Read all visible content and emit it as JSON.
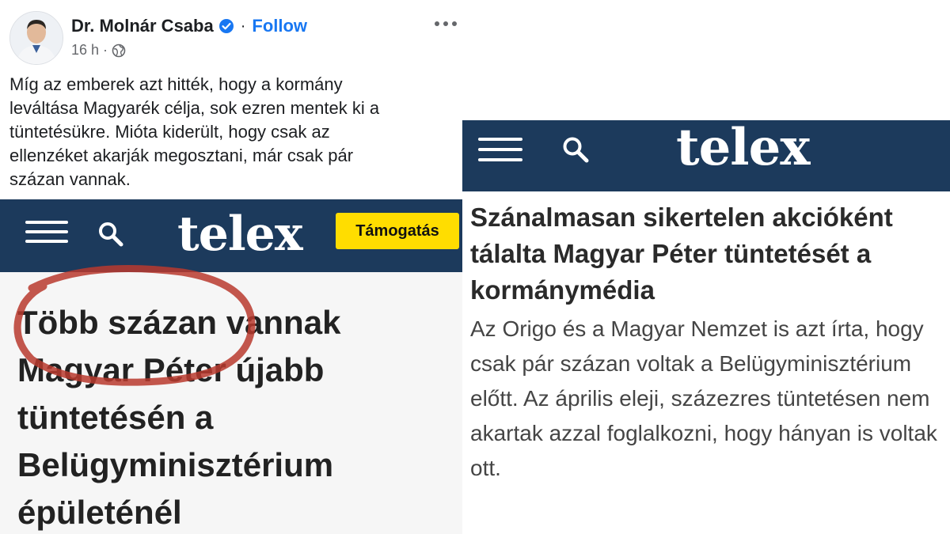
{
  "post": {
    "author": "Dr. Molnár Csaba",
    "follow_label": "Follow",
    "separator": "·",
    "time": "16 h",
    "time_separator": "·",
    "text": "Míg az emberek azt hitték, hogy a kormány\nleváltása Magyarék célja, sok ezren mentek ki a\ntüntetésükre. Mióta kiderült, hogy csak az\nellenzéket akarják megosztani, már csak pár\nszázan vannak.",
    "icons": [
      "verified-badge-icon",
      "globe-icon",
      "more-options-icon"
    ]
  },
  "telex_left": {
    "logo": "telex",
    "support_label": "Támogatás",
    "headline": "Több százan vannak Magyar Péter újabb tüntetésén a Belügyminisztérium épületénél",
    "icons": [
      "menu-icon",
      "search-icon"
    ]
  },
  "telex_right": {
    "logo": "telex",
    "headline": "Szánalmasan sikertelen akcióként tálalta Magyar Péter tüntetését a kormánymédia",
    "lead": "Az Origo és a Magyar Nemzet is azt írta, hogy csak pár százan voltak a Belügyminisztérium előtt. Az április eleji, százezres tüntetésen nem akartak azzal foglalkozni, hogy hányan is voltak ott.",
    "icons": [
      "menu-icon",
      "search-icon"
    ]
  },
  "colors": {
    "telex_navy": "#1c3a5c",
    "support_yellow": "#ffdd00",
    "facebook_blue": "#1877f2",
    "annotation_red": "#b83a2e"
  }
}
